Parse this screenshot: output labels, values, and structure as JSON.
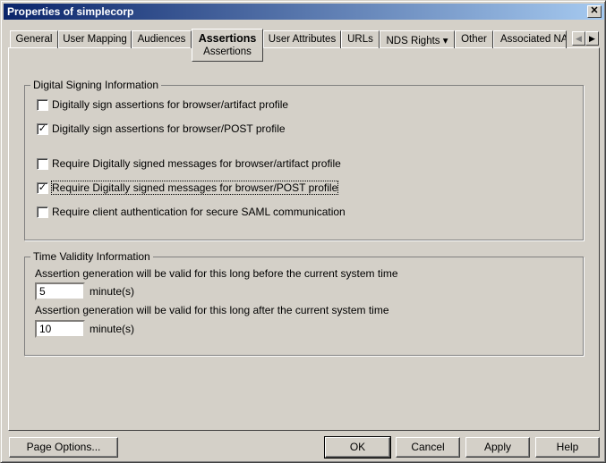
{
  "window": {
    "title": "Properties of simplecorp",
    "close_icon": "close-icon"
  },
  "tabs": [
    {
      "label": "General"
    },
    {
      "label": "User Mapping"
    },
    {
      "label": "Audiences"
    },
    {
      "label": "Assertions",
      "sub": "Assertions",
      "active": true
    },
    {
      "label": "User Attributes"
    },
    {
      "label": "URLs"
    },
    {
      "label": "NDS Rights ▾"
    },
    {
      "label": "Other"
    },
    {
      "label": "Associated NA"
    }
  ],
  "signing": {
    "legend": "Digital Signing Information",
    "options": [
      {
        "label": "Digitally sign assertions for browser/artifact profile",
        "checked": false
      },
      {
        "label": "Digitally sign assertions for browser/POST profile",
        "checked": true
      },
      {
        "label": "Require Digitally signed messages for browser/artifact profile",
        "checked": false
      },
      {
        "label": "Require Digitally signed messages for browser/POST profile",
        "checked": true
      },
      {
        "label": "Require client authentication for secure SAML communication",
        "checked": false
      }
    ]
  },
  "validity": {
    "legend": "Time Validity Information",
    "before_label": "Assertion generation will be valid for this long before the current system time",
    "before_value": "5",
    "after_label": "Assertion generation will be valid for this long after the current system time",
    "after_value": "10",
    "unit": "minute(s)"
  },
  "buttons": {
    "page_options": "Page Options...",
    "ok": "OK",
    "cancel": "Cancel",
    "apply": "Apply",
    "help": "Help"
  }
}
